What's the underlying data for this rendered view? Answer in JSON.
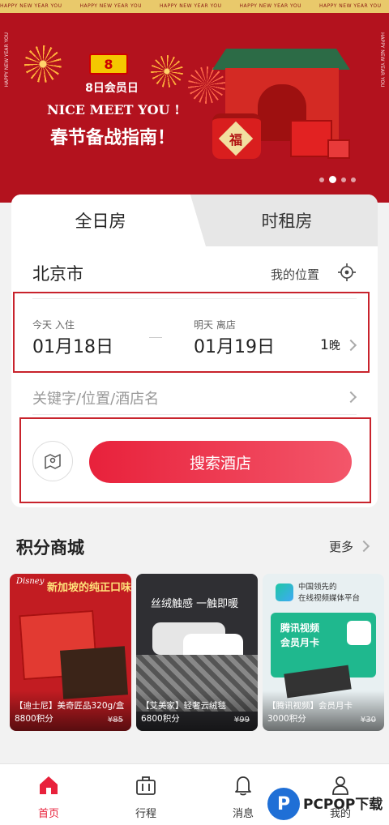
{
  "banner": {
    "ticker": "HAPPY NEW YEAR YOU",
    "side_text": "HAPPY NEW YEAR YOU",
    "logo_text": "8",
    "member_day": "8日会员日",
    "nice_meet_you": "NICE MEET YOU !",
    "headline": "春节备战指南！",
    "fu_char": "福",
    "page_count": 4,
    "active_page": 2
  },
  "tabs": {
    "full_day": "全日房",
    "hourly": "时租房"
  },
  "location": {
    "city": "北京市",
    "my_location": "我的位置"
  },
  "dates": {
    "checkin_label": "今天 入住",
    "checkin_date": "01月18日",
    "checkout_label": "明天 离店",
    "checkout_date": "01月19日",
    "nights_num": "1",
    "nights_unit": "晚"
  },
  "keyword": {
    "placeholder": "关键字/位置/酒店名"
  },
  "search": {
    "button_label": "搜索酒店"
  },
  "mall": {
    "title": "积分商城",
    "more": "更多",
    "products": [
      {
        "banner": "新加坡的纯正口味",
        "logo": "Disney",
        "name": "【迪士尼】美奇匠品320g/盒",
        "points": "8800积分",
        "original_price": "¥85"
      },
      {
        "banner": "丝绒触感 一触即暖",
        "name": "【艾美家】轻奢云绒毯",
        "points": "6800积分",
        "original_price": "¥99"
      },
      {
        "banner_line1": "中国领先的",
        "banner_line2": "在线视频媒体平台",
        "card_line1": "腾讯视频",
        "card_line2": "会员月卡",
        "name": "【腾讯视频】会员月卡",
        "points": "3000积分",
        "original_price": "¥30"
      }
    ]
  },
  "nav": {
    "home": "首页",
    "trips": "行程",
    "messages": "消息",
    "mine": "我的"
  },
  "watermark": {
    "logo_letter": "P",
    "text": "PCPOP下载"
  },
  "colors": {
    "brand_red": "#e8213b",
    "banner_red": "#b3121e",
    "highlight_border": "#c8232c"
  }
}
